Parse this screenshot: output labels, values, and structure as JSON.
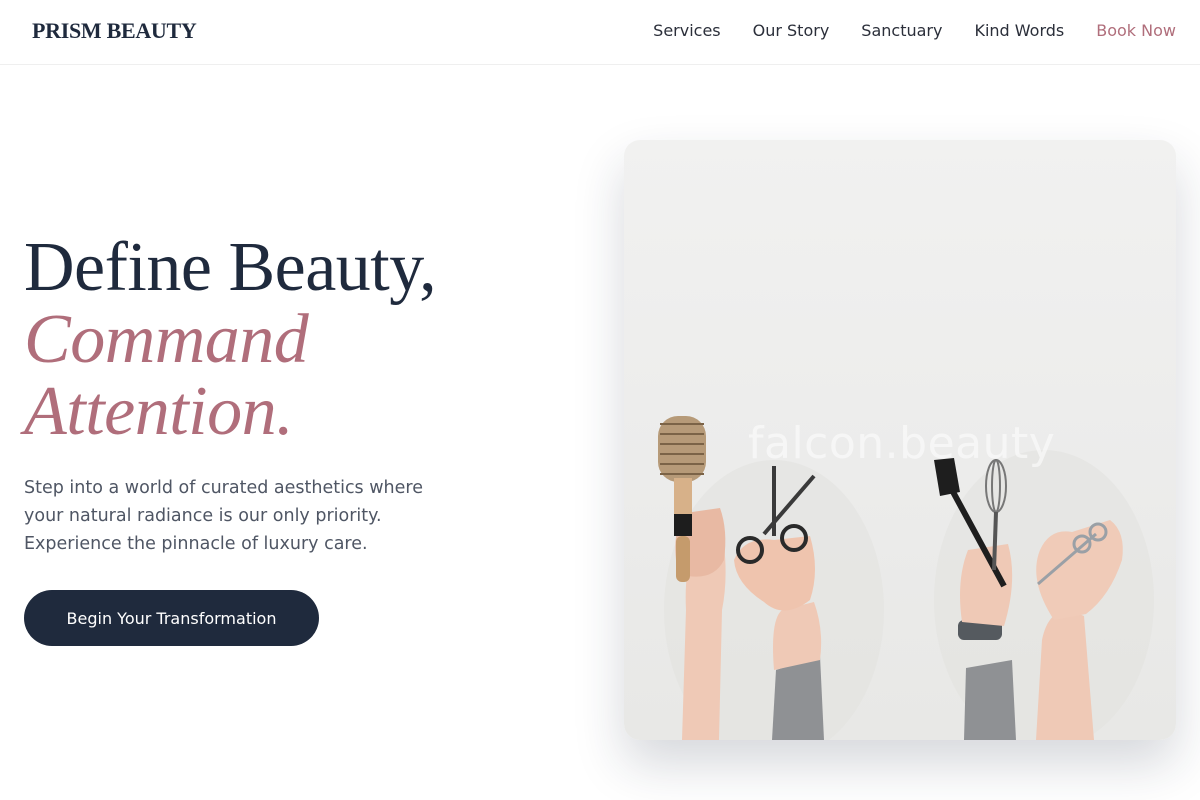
{
  "brand": {
    "name": "PRISM BEAUTY"
  },
  "nav": {
    "items": [
      {
        "label": "Services"
      },
      {
        "label": "Our Story"
      },
      {
        "label": "Sanctuary"
      },
      {
        "label": "Kind Words"
      },
      {
        "label": "Book Now"
      }
    ]
  },
  "hero": {
    "title_line1": "Define Beauty,",
    "title_line2": "Command",
    "title_line3": "Attention.",
    "subtitle": "Step into a world of curated aesthetics where your natural radiance is our only priority. Experience the pinnacle of luxury care.",
    "cta_label": "Begin Your Transformation",
    "image_watermark": "falcon.beauty"
  },
  "colors": {
    "navy": "#1f2a3d",
    "accent_rose": "#b06e7b",
    "body_text": "#4f5664"
  }
}
